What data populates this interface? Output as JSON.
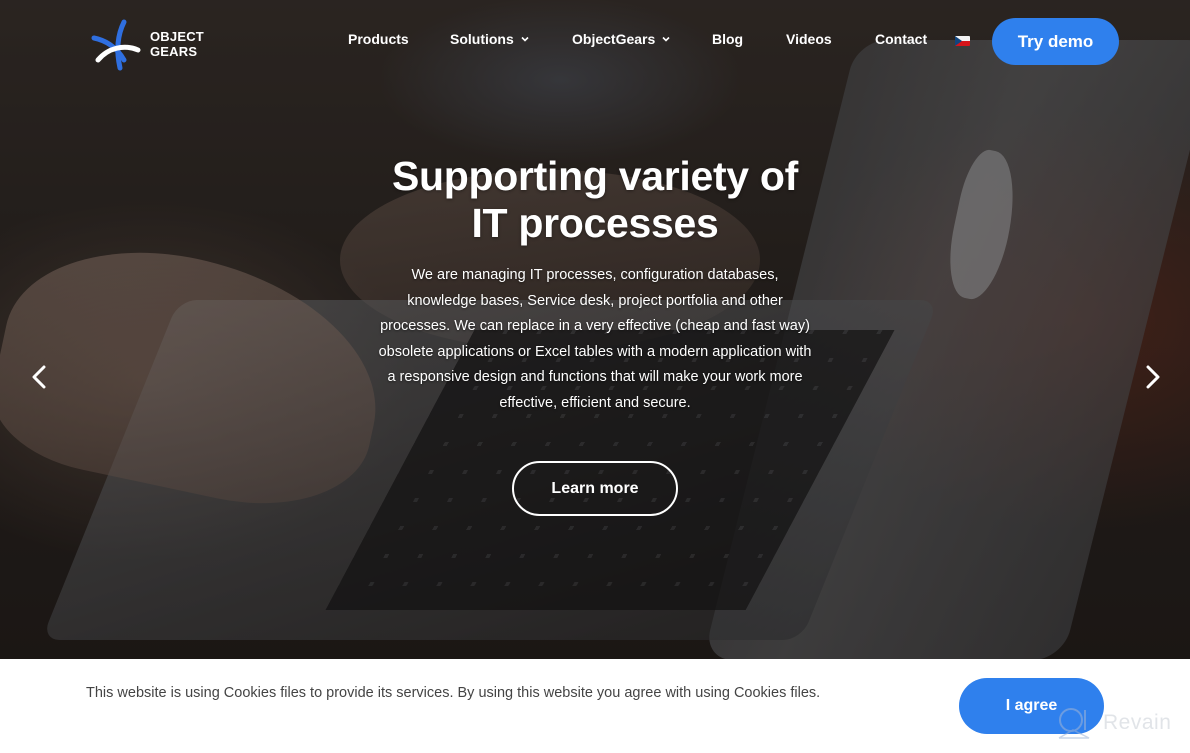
{
  "brand": {
    "name_line1": "OBJECT",
    "name_line2": "GEARS",
    "colors": {
      "accent": "#2f80ed",
      "logo_blue": "#2f6fe0",
      "text_dark": "#444444",
      "white": "#ffffff"
    }
  },
  "nav": {
    "items": [
      {
        "label": "Products",
        "dropdown": false
      },
      {
        "label": "Solutions",
        "dropdown": true
      },
      {
        "label": "ObjectGears",
        "dropdown": true
      },
      {
        "label": "Blog",
        "dropdown": false
      },
      {
        "label": "Videos",
        "dropdown": false
      },
      {
        "label": "Contact",
        "dropdown": false
      }
    ],
    "language_flag": "czech-flag-icon",
    "cta_label": "Try demo"
  },
  "hero": {
    "title_line1": "Supporting variety of",
    "title_line2": "IT processes",
    "description": "We are managing IT processes, configuration databases, knowledge bases, Service desk, project portfolia and other processes. We can replace in a very effective (cheap and fast way) obsolete applications or Excel tables with a modern application with a responsive design and functions that will make your work more effective, efficient and secure.",
    "button_label": "Learn more",
    "prev_icon": "chevron-left-icon",
    "next_icon": "chevron-right-icon"
  },
  "cookie_bar": {
    "text": "This website is using Cookies files to provide its services. By using this website you agree with using Cookies files.",
    "button_label": "I agree"
  },
  "watermark": {
    "text": "Revain"
  }
}
